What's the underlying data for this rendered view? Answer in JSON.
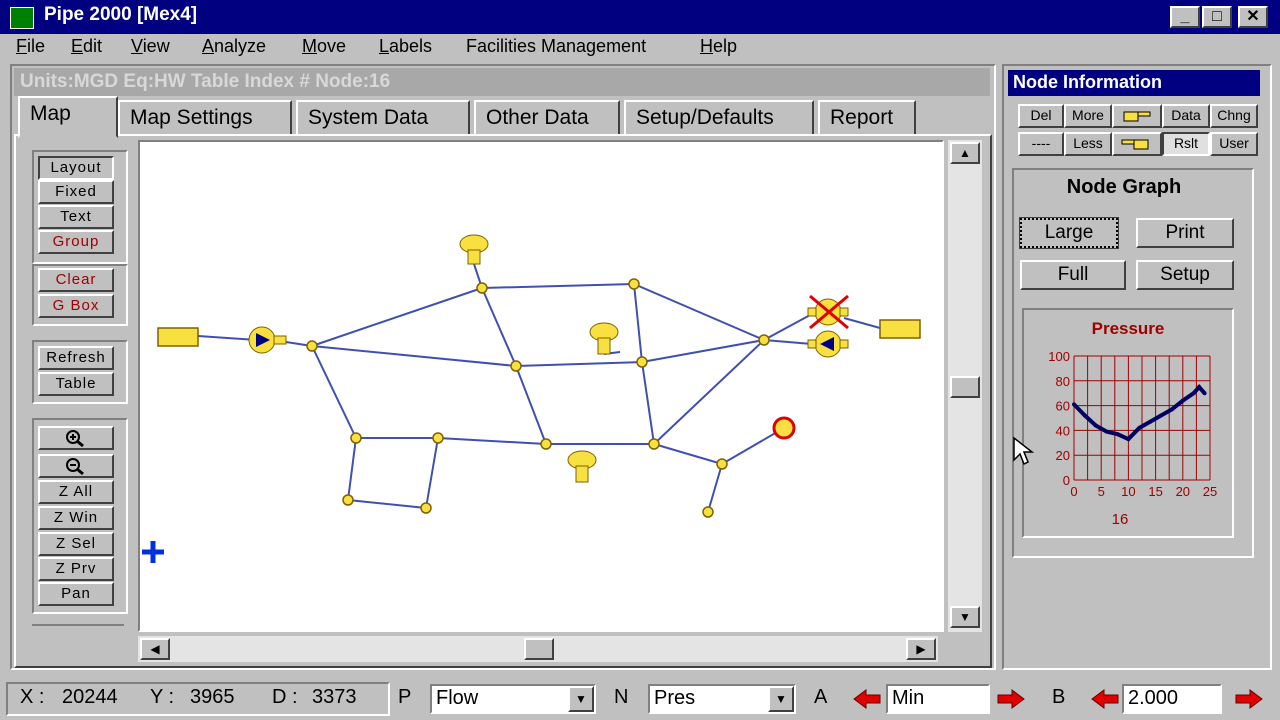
{
  "window": {
    "title": "Pipe 2000  [Mex4]",
    "min": "_",
    "max": "□",
    "close": "✕"
  },
  "menu": [
    "File",
    "Edit",
    "View",
    "Analyze",
    "Move",
    "Labels",
    "Facilities Management",
    "Help"
  ],
  "info_bar": "Units:MGD  Eq:HW  Table Index #  Node:16",
  "tabs": [
    "Map",
    "Map Settings",
    "System Data",
    "Other Data",
    "Setup/Defaults",
    "Report"
  ],
  "tools": {
    "group1": [
      "Layout",
      "Fixed",
      "Text",
      "Group"
    ],
    "group2": [
      "Clear",
      "G Box"
    ],
    "group3": [
      "Refresh",
      "Table"
    ],
    "group4": [
      "Z All",
      "Z Win",
      "Z Sel",
      "Z Prv",
      "Pan"
    ]
  },
  "node_info": {
    "title": "Node Information",
    "row1": [
      "Del",
      "More",
      "",
      "Data",
      "Chng"
    ],
    "row2": [
      "----",
      "Less",
      "",
      "Rslt",
      "User"
    ],
    "graph_title": "Node Graph",
    "buttons": [
      "Large",
      "Print",
      "Full",
      "Setup"
    ]
  },
  "chart_data": {
    "type": "line",
    "title": "Pressure",
    "xlabel": "16",
    "ylabel": "",
    "x_ticks": [
      0,
      5,
      10,
      15,
      20,
      25
    ],
    "y_ticks": [
      0,
      20,
      40,
      60,
      80,
      100
    ],
    "xlim": [
      0,
      25
    ],
    "ylim": [
      0,
      100
    ],
    "grid": true,
    "series": [
      {
        "x": [
          0,
          2,
          4,
          6,
          8,
          10,
          12,
          14,
          16,
          18,
          20,
          22,
          23,
          24
        ],
        "y": [
          61,
          52,
          44,
          39,
          37,
          33,
          42,
          47,
          52,
          57,
          64,
          70,
          75,
          70
        ]
      }
    ]
  },
  "status": {
    "x_label": "X :",
    "x_value": "20244",
    "y_label": "Y :",
    "y_value": "3965",
    "d_label": "D :",
    "d_value": "3373",
    "p_label": "P",
    "p_value": "Flow",
    "n_label": "N",
    "n_value": "Pres",
    "a_label": "A",
    "a_value": "Min",
    "b_label": "B",
    "b_value": "2.000"
  },
  "colors": {
    "title_bar": "#000080",
    "pipe": "#4050b0",
    "node_fill": "#f8e040",
    "chart_line": "#000060",
    "chart_grid": "#a00000"
  }
}
